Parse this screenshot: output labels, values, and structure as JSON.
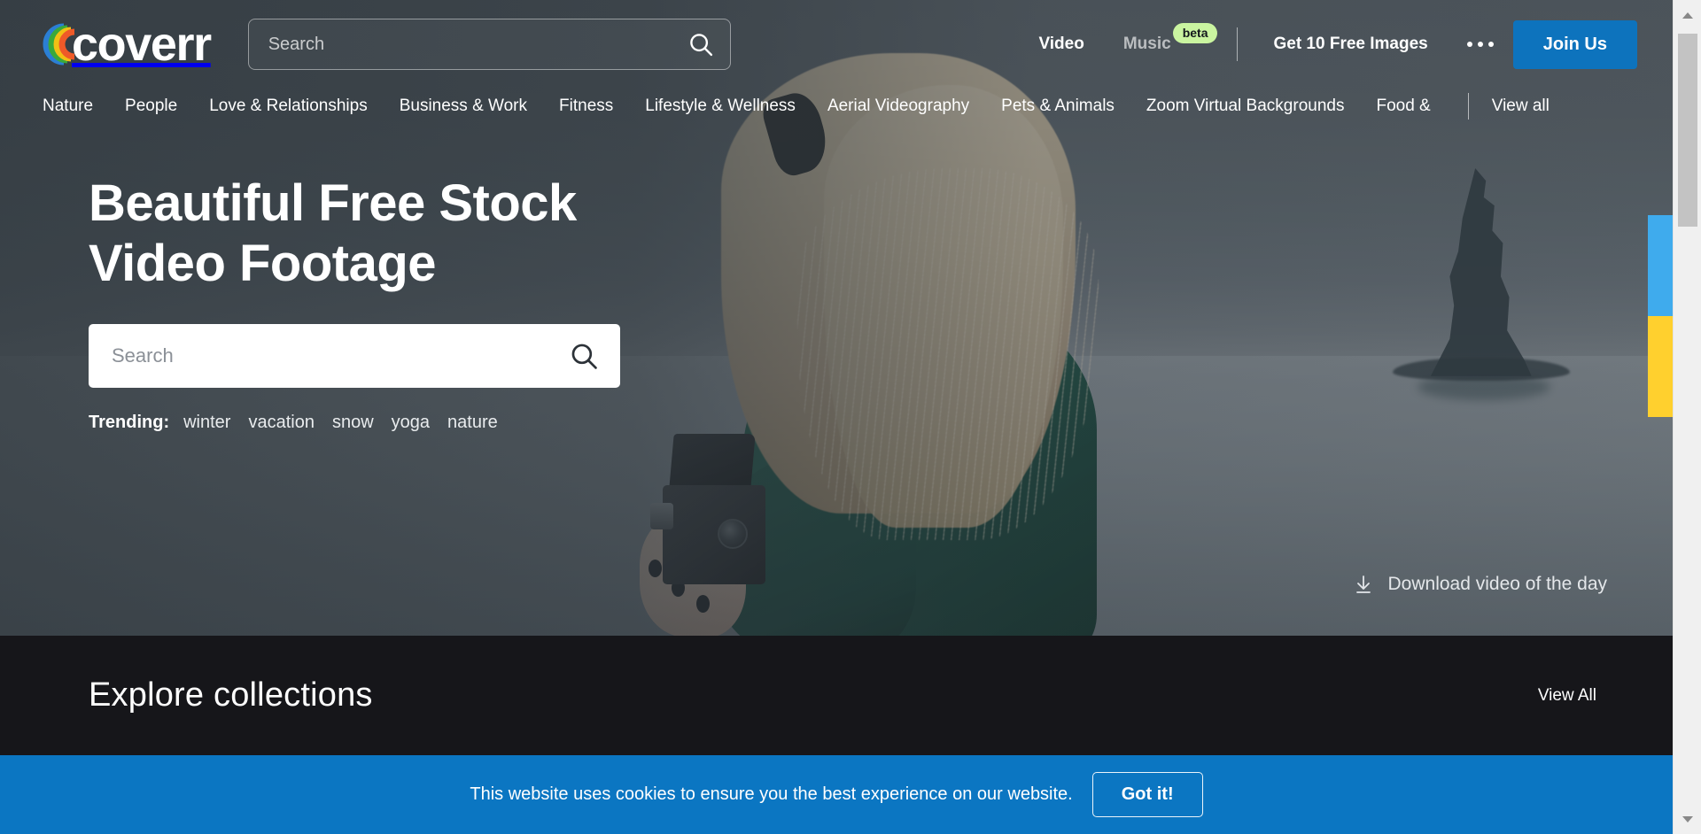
{
  "brand": {
    "name": "coverr",
    "logo_colors": [
      "#2b7fd4",
      "#3aa93a",
      "#f2c014",
      "#f07524",
      "#e8332a"
    ]
  },
  "header": {
    "search": {
      "placeholder": "Search",
      "value": "",
      "icon": "search-icon"
    },
    "nav": [
      {
        "label": "Video",
        "muted": false,
        "badge": null
      },
      {
        "label": "Music",
        "muted": true,
        "badge": "beta"
      }
    ],
    "free_images_label": "Get 10 Free Images",
    "more_icon": "ellipsis-icon",
    "join_label": "Join Us",
    "join_color": "#0d73bd",
    "beta_badge_color": "#caf5a0"
  },
  "categories": {
    "items": [
      "Nature",
      "People",
      "Love & Relationships",
      "Business & Work",
      "Fitness",
      "Lifestyle & Wellness",
      "Aerial Videography",
      "Pets & Animals",
      "Zoom Virtual Backgrounds",
      "Food &"
    ],
    "view_all": "View all"
  },
  "hero": {
    "title_line1": "Beautiful Free Stock",
    "title_line2": "Video Footage",
    "search": {
      "placeholder": "Search",
      "value": "",
      "icon": "search-icon"
    },
    "trending_label": "Trending:",
    "trending_tags": [
      "winter",
      "vacation",
      "snow",
      "yoga",
      "nature"
    ],
    "download_label": "Download video of the day",
    "download_icon": "download-icon"
  },
  "ukraine_strip": {
    "blue": "#3fabed",
    "yellow": "#ffd02e"
  },
  "explore": {
    "title": "Explore collections",
    "view_all": "View All",
    "background": "#16161a"
  },
  "cookie": {
    "message": "This website uses cookies to ensure you the best experience on our website.",
    "button_label": "Got it!",
    "background": "#0b76c2"
  },
  "scrollbar": {
    "up_icon": "scroll-up-arrow",
    "down_icon": "scroll-down-arrow"
  }
}
